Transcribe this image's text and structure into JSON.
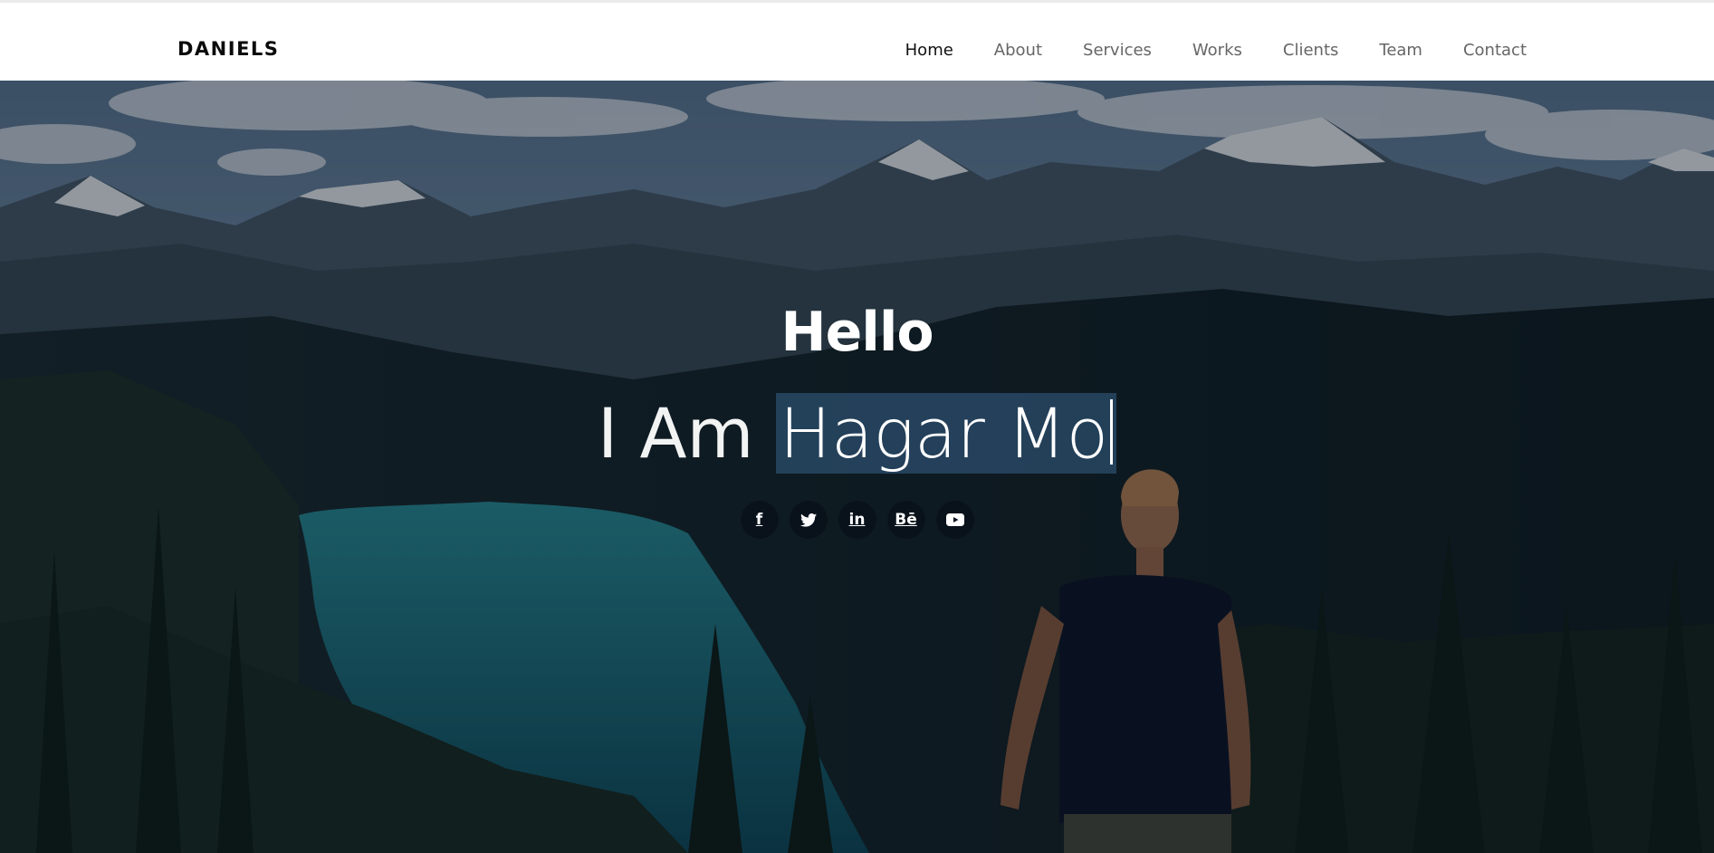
{
  "brand": "DANIELS",
  "nav": {
    "items": [
      {
        "label": "Home",
        "active": true
      },
      {
        "label": "About"
      },
      {
        "label": "Services"
      },
      {
        "label": "Works"
      },
      {
        "label": "Clients"
      },
      {
        "label": "Team"
      },
      {
        "label": "Contact"
      }
    ]
  },
  "hero": {
    "greeting": "Hello",
    "tagline_prefix": "I Am ",
    "tagline_selected": "Hagar Mo",
    "background_image": "mountain lake landscape with man in tank top",
    "socials": [
      {
        "icon": "facebook-icon",
        "glyph": "f"
      },
      {
        "icon": "twitter-icon",
        "glyph": ""
      },
      {
        "icon": "linkedin-icon",
        "glyph": "in"
      },
      {
        "icon": "behance-icon",
        "glyph": "Bē"
      },
      {
        "icon": "youtube-icon",
        "glyph": ""
      }
    ]
  },
  "colors": {
    "nav_bg": "#ffffff",
    "nav_text": "#666666",
    "nav_active": "#111111",
    "selection": "#284864"
  }
}
